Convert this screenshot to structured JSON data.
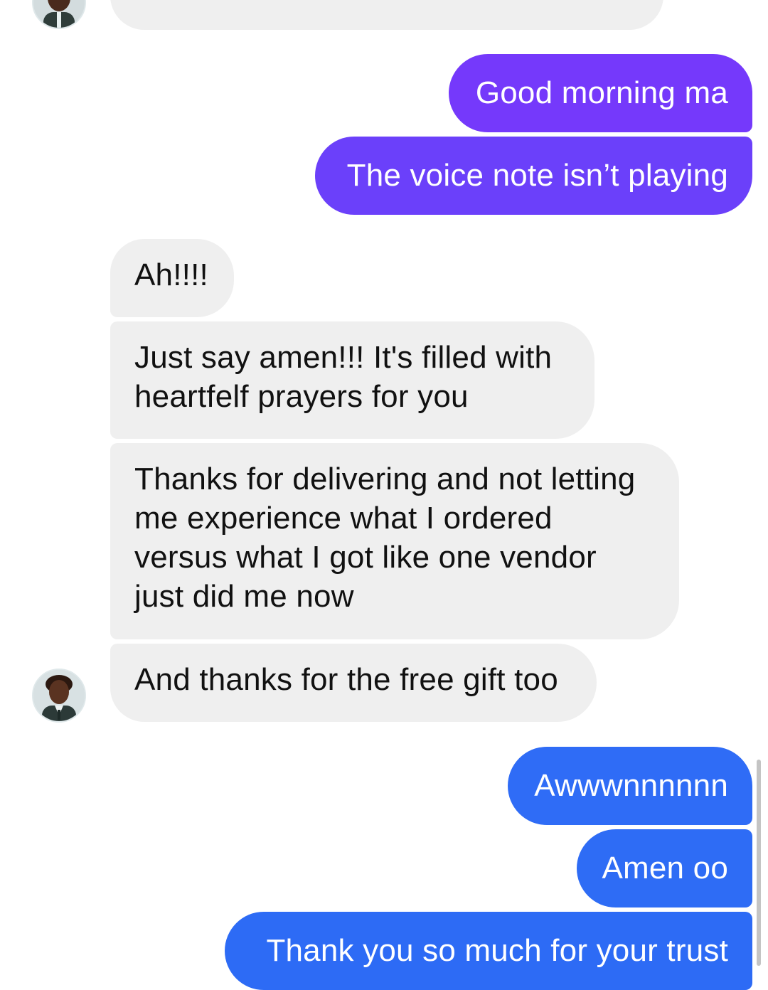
{
  "conversation": {
    "messages": [
      {
        "sender": "contact",
        "text": ""
      },
      {
        "sender": "me",
        "text": "Good morning ma"
      },
      {
        "sender": "me",
        "text": "The voice note isn’t playing"
      },
      {
        "sender": "contact",
        "text": "Ah!!!!"
      },
      {
        "sender": "contact",
        "lines": [
          "Just say amen!!! It's filled with",
          "heartfelf prayers for you"
        ]
      },
      {
        "sender": "contact",
        "lines": [
          "Thanks for delivering and not letting",
          "me experience what I ordered",
          "versus what I got like one vendor",
          "just did me now"
        ]
      },
      {
        "sender": "contact",
        "text": "And thanks for the free gift too"
      },
      {
        "sender": "me",
        "text": "Awwwnnnnnn"
      },
      {
        "sender": "me",
        "text": "Amen oo"
      },
      {
        "sender": "me",
        "text": "Thank you so much for your trust"
      }
    ]
  },
  "colors": {
    "incoming_bubble": "#efefef",
    "outgoing_purple": "#7539fb",
    "outgoing_blue": "#2f6cf6"
  },
  "icons": {
    "avatar": "contact-avatar-photo"
  }
}
